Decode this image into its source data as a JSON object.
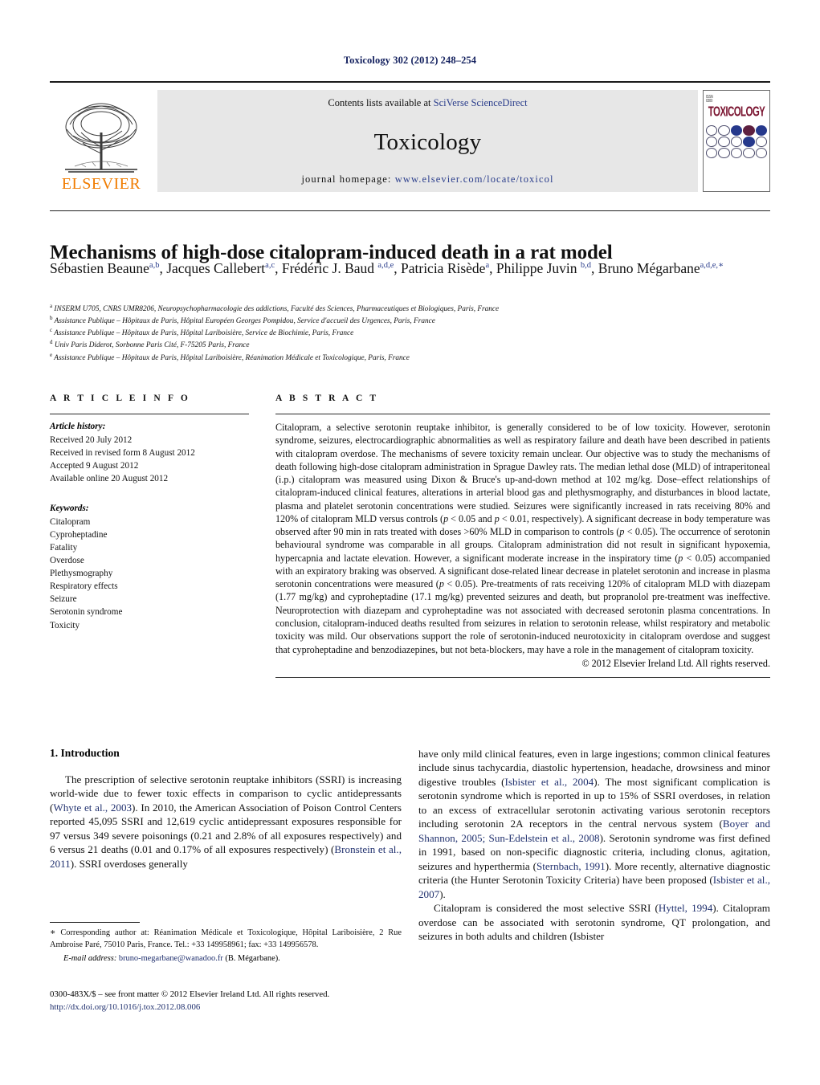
{
  "running_head": "Toxicology 302 (2012) 248–254",
  "masthead": {
    "publisher": "ELSEVIER",
    "contents_prefix": "Contents lists available at ",
    "contents_link": "SciVerse ScienceDirect",
    "journal_name": "Toxicology",
    "homepage_prefix": "journal homepage: ",
    "homepage_url": "www.elsevier.com/locate/toxicol",
    "cover": {
      "tiny_label": "ISSN\n0300-483X",
      "title": "TOXICOLOGY"
    }
  },
  "article": {
    "title": "Mechanisms of high-dose citalopram-induced death in a rat model",
    "authors_html": "Sébastien Beaune<sup>a,b</sup>, Jacques Callebert<sup>a,c</sup>, Frédéric J. Baud <sup>a,d,e</sup>, Patricia Risède<sup>a</sup>, Philippe Juvin <sup>b,d</sup>, Bruno Mégarbane<sup>a,d,e,∗</sup>",
    "affiliations": [
      {
        "marker": "a",
        "text": "INSERM U705, CNRS UMR8206, Neuropsychopharmacologie des addictions, Faculté des Sciences, Pharmaceutiques et Biologiques, Paris, France"
      },
      {
        "marker": "b",
        "text": "Assistance Publique – Hôpitaux de Paris, Hôpital Européen Georges Pompidou, Service d'accueil des Urgences, Paris, France"
      },
      {
        "marker": "c",
        "text": "Assistance Publique – Hôpitaux de Paris, Hôpital Lariboisière, Service de Biochimie, Paris, France"
      },
      {
        "marker": "d",
        "text": "Univ Paris Diderot, Sorbonne Paris Cité, F-75205 Paris, France"
      },
      {
        "marker": "e",
        "text": "Assistance Publique – Hôpitaux de Paris, Hôpital Lariboisière, Réanimation Médicale et Toxicologique, Paris, France"
      }
    ]
  },
  "article_info": {
    "heading": "A R T I C L E   I N F O",
    "history_label": "Article history:",
    "history": [
      "Received 20 July 2012",
      "Received in revised form 8 August 2012",
      "Accepted 9 August 2012",
      "Available online 20 August 2012"
    ],
    "keywords_label": "Keywords:",
    "keywords": [
      "Citalopram",
      "Cyproheptadine",
      "Fatality",
      "Overdose",
      "Plethysmography",
      "Respiratory effects",
      "Seizure",
      "Serotonin syndrome",
      "Toxicity"
    ]
  },
  "abstract": {
    "heading": "A B S T R A C T",
    "text": "Citalopram, a selective serotonin reuptake inhibitor, is generally considered to be of low toxicity. However, serotonin syndrome, seizures, electrocardiographic abnormalities as well as respiratory failure and death have been described in patients with citalopram overdose. The mechanisms of severe toxicity remain unclear. Our objective was to study the mechanisms of death following high-dose citalopram administration in Sprague Dawley rats. The median lethal dose (MLD) of intraperitoneal (i.p.) citalopram was measured using Dixon & Bruce's up-and-down method at 102 mg/kg. Dose–effect relationships of citalopram-induced clinical features, alterations in arterial blood gas and plethysmography, and disturbances in blood lactate, plasma and platelet serotonin concentrations were studied. Seizures were significantly increased in rats receiving 80% and 120% of citalopram MLD versus controls (p < 0.05 and p < 0.01, respectively). A significant decrease in body temperature was observed after 90 min in rats treated with doses >60% MLD in comparison to controls (p < 0.05). The occurrence of serotonin behavioural syndrome was comparable in all groups. Citalopram administration did not result in significant hypoxemia, hypercapnia and lactate elevation. However, a significant moderate increase in the inspiratory time (p < 0.05) accompanied with an expiratory braking was observed. A significant dose-related linear decrease in platelet serotonin and increase in plasma serotonin concentrations were measured (p < 0.05). Pre-treatments of rats receiving 120% of citalopram MLD with diazepam (1.77 mg/kg) and cyproheptadine (17.1 mg/kg) prevented seizures and death, but propranolol pre-treatment was ineffective. Neuroprotection with diazepam and cyproheptadine was not associated with decreased serotonin plasma concentrations. In conclusion, citalopram-induced deaths resulted from seizures in relation to serotonin release, whilst respiratory and metabolic toxicity was mild. Our observations support the role of serotonin-induced neurotoxicity in citalopram overdose and suggest that cyproheptadine and benzodiazepines, but not beta-blockers, may have a role in the management of citalopram toxicity.",
    "copyright": "© 2012 Elsevier Ireland Ltd. All rights reserved."
  },
  "body": {
    "section_number_title": "1.  Introduction",
    "left_paragraph": "The prescription of selective serotonin reuptake inhibitors (SSRI) is increasing world-wide due to fewer toxic effects in comparison to cyclic antidepressants (Whyte et al., 2003). In 2010, the American Association of Poison Control Centers reported 45,095 SSRI and 12,619 cyclic antidepressant exposures responsible for 97 versus 349 severe poisonings (0.21 and 2.8% of all exposures respectively) and 6 versus 21 deaths (0.01 and 0.17% of all exposures respectively) (Bronstein et al., 2011). SSRI overdoses generally",
    "right_paragraph_1": "have only mild clinical features, even in large ingestions; common clinical features include sinus tachycardia, diastolic hypertension, headache, drowsiness and minor digestive troubles (Isbister et al., 2004). The most significant complication is serotonin syndrome which is reported in up to 15% of SSRI overdoses, in relation to an excess of extracellular serotonin activating various serotonin receptors including serotonin 2A receptors in the central nervous system (Boyer and Shannon, 2005; Sun-Edelstein et al., 2008). Serotonin syndrome was first defined in 1991, based on non-specific diagnostic criteria, including clonus, agitation, seizures and hyperthermia (Sternbach, 1991). More recently, alternative diagnostic criteria (the Hunter Serotonin Toxicity Criteria) have been proposed (Isbister et al., 2007).",
    "right_paragraph_2": "Citalopram is considered the most selective SSRI (Hyttel, 1994). Citalopram overdose can be associated with serotonin syndrome, QT prolongation, and seizures in both adults and children (Isbister"
  },
  "footnotes": {
    "corresponding": "Corresponding author at: Réanimation Médicale et Toxicologique, Hôpital Lariboisière, 2 Rue Ambroise Paré, 75010 Paris, France. Tel.: +33 149958961; fax: +33 149956578.",
    "email_label": "E-mail address:",
    "email": "bruno-megarbane@wanadoo.fr",
    "email_owner": "(B. Mégarbane).",
    "issn_line": "0300-483X/$ – see front matter © 2012 Elsevier Ireland Ltd. All rights reserved.",
    "doi": "http://dx.doi.org/10.1016/j.tox.2012.08.006"
  },
  "colors": {
    "link_navy": "#20306e",
    "masthead_gray": "#e7e7e7",
    "elsevier_orange": "#f07c00",
    "cover_maroon": "#7a1430"
  }
}
